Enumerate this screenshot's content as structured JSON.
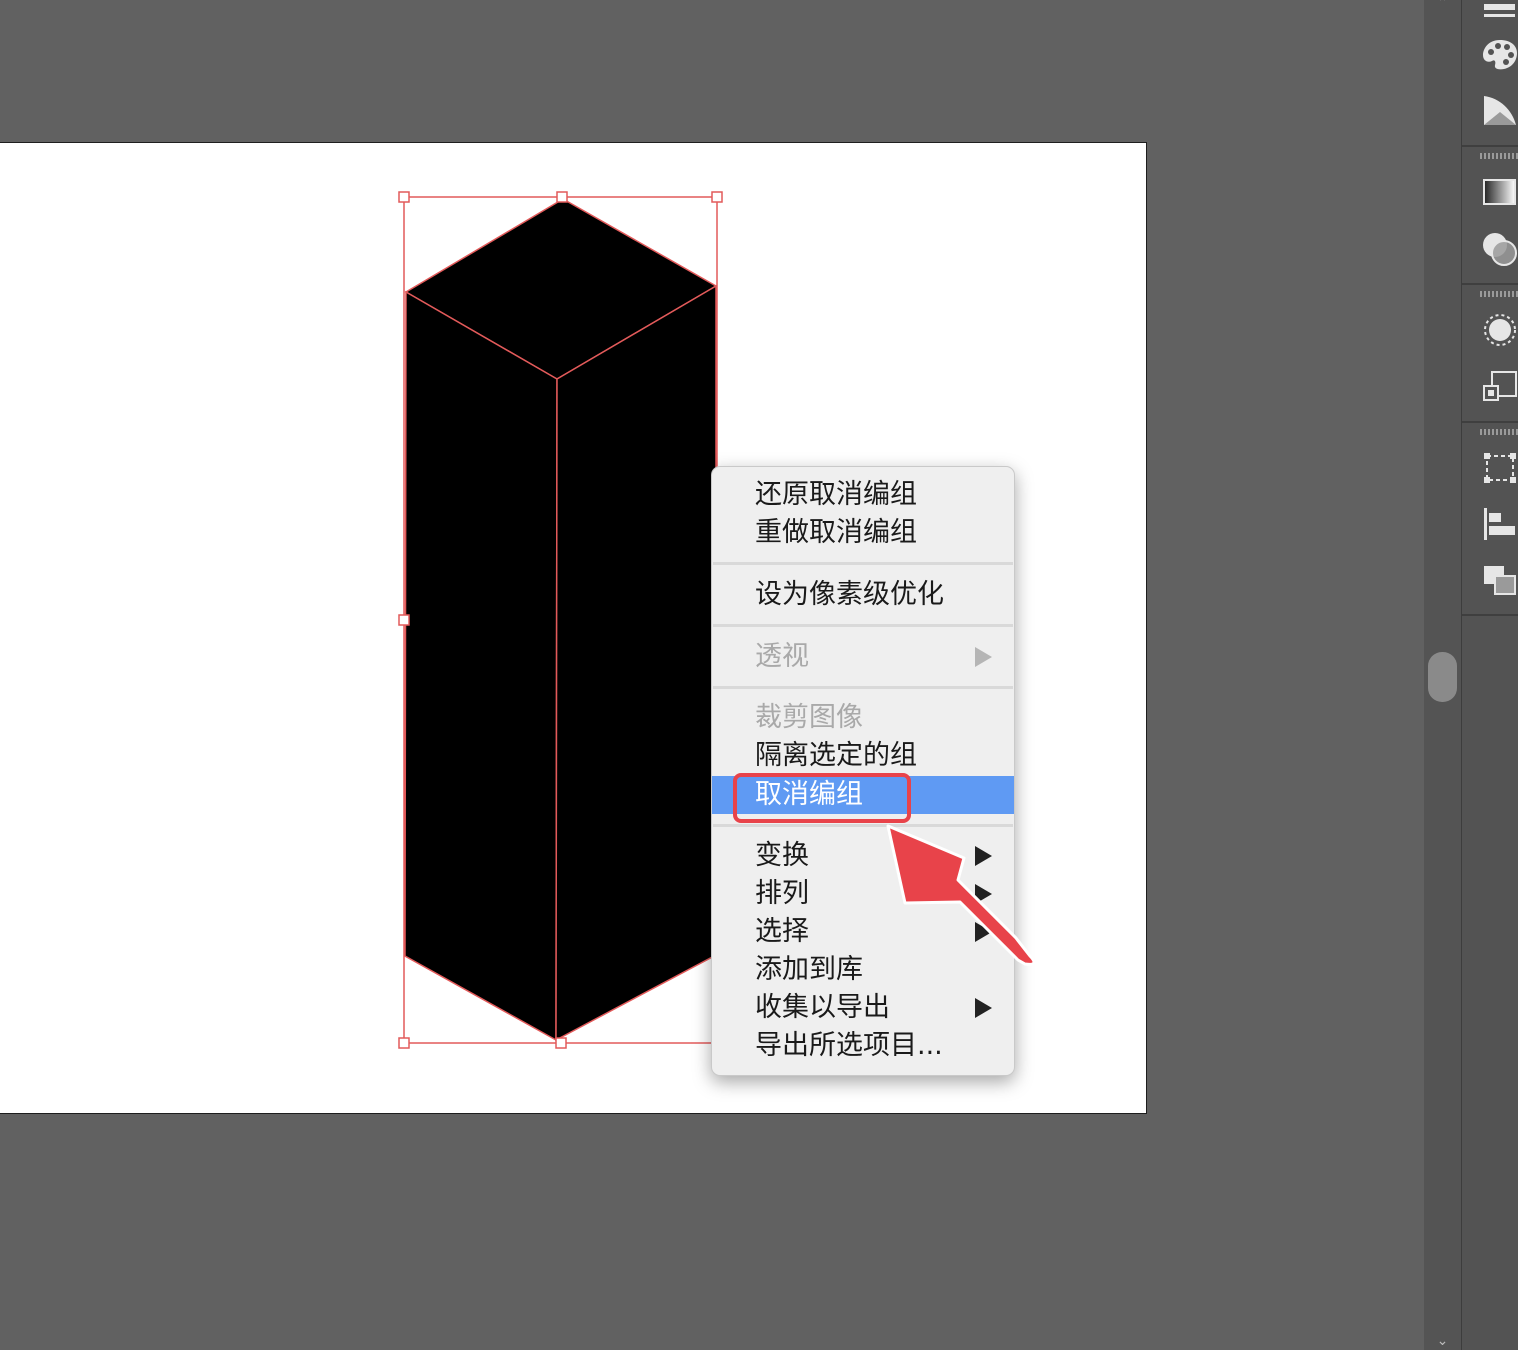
{
  "context_menu": {
    "items": [
      {
        "label": "还原取消编组"
      },
      {
        "label": "重做取消编组"
      },
      {
        "label": "设为像素级优化"
      },
      {
        "label": "透视"
      },
      {
        "label": "裁剪图像"
      },
      {
        "label": "隔离选定的组"
      },
      {
        "label": "取消编组"
      },
      {
        "label": "变换"
      },
      {
        "label": "排列"
      },
      {
        "label": "选择"
      },
      {
        "label": "添加到库"
      },
      {
        "label": "收集以导出"
      },
      {
        "label": "导出所选项目..."
      }
    ],
    "highlighted": "取消编组",
    "disabled": [
      "透视",
      "裁剪图像"
    ]
  },
  "colors": {
    "workspace": "#616161",
    "selection": "#e25a5a",
    "menu_highlight": "#5f9af3",
    "annotation": "#e8434a"
  },
  "dock_icons": [
    "brush-library-icon",
    "color-palette-icon",
    "color-guide-icon",
    "gradient-icon",
    "transparency-icon",
    "appearance-icon",
    "graphic-styles-icon",
    "transform-icon",
    "align-icon",
    "pathfinder-icon"
  ]
}
